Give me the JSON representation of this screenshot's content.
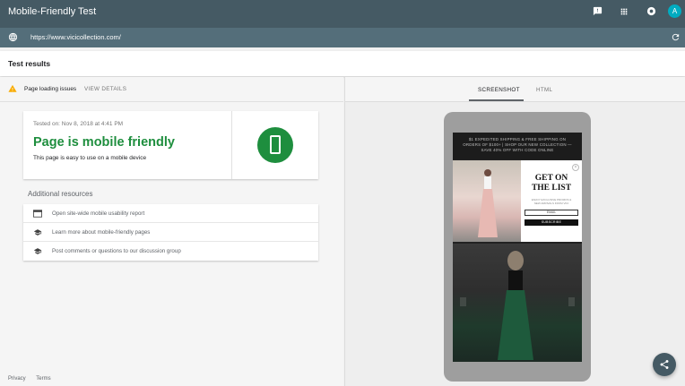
{
  "app": {
    "title": "Mobile-Friendly Test",
    "avatar_letter": "A"
  },
  "url_bar": {
    "url": "https://www.vicicollection.com/"
  },
  "results": {
    "heading": "Test results",
    "issues_label": "Page loading issues",
    "view_details": "VIEW DETAILS"
  },
  "summary": {
    "tested_on": "Tested on: Nov 8, 2018 at 4:41 PM",
    "headline": "Page is mobile friendly",
    "subtext": "This page is easy to use on a mobile device",
    "status_color": "#1e8e3e"
  },
  "additional": {
    "heading": "Additional resources",
    "items": [
      {
        "label": "Open site-wide mobile usability report",
        "icon": "browser-window-icon"
      },
      {
        "label": "Learn more about mobile-friendly pages",
        "icon": "graduation-cap-icon"
      },
      {
        "label": "Post comments or questions to our discussion group",
        "icon": "graduation-cap-icon"
      }
    ]
  },
  "footer": {
    "privacy": "Privacy",
    "terms": "Terms"
  },
  "preview": {
    "tabs": [
      "SCREENSHOT",
      "HTML"
    ],
    "active_tab": "SCREENSHOT",
    "promo_text": "$1 EXPEDITED SHIPPING & FREE SHIPPING ON ORDERS OF $100+ | SHOP OUR NEW COLLECTION — SAVE 40% OFF WITH CODE ONLINE",
    "popup_title_line1": "GET ON",
    "popup_title_line2": "THE LIST",
    "popup_fine_print": "ENJOY EXCLUSIVE PROMOS & NEW ARRIVALS FROM VICI",
    "popup_email": "EMAIL",
    "popup_subscribe": "SUBSCRIBE",
    "popup_close": "×"
  }
}
